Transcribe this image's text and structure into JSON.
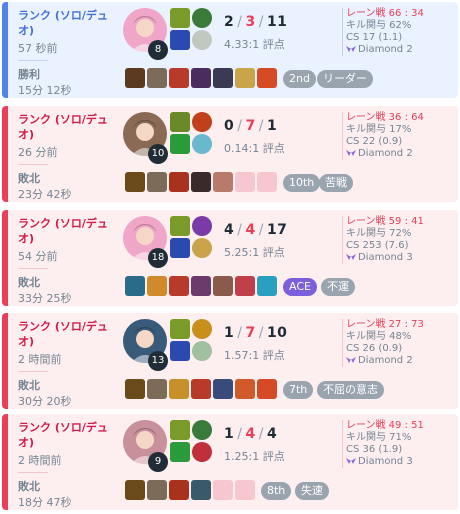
{
  "matches": [
    {
      "result_type": "win",
      "queue": "ランク (ソロ/デュオ)",
      "ago": "57 秒前",
      "result": "勝利",
      "duration": "15分 12秒",
      "level": "8",
      "kills": "2",
      "deaths": "3",
      "assists": "11",
      "ratio": "4.33:1 評点",
      "lane": "レーン戦 66 : 34",
      "kill_participation": "キル関与 62%",
      "cs": "CS 17 (1.1)",
      "rank": "Diamond 2",
      "place": "2nd",
      "tag": "リーダー",
      "champion_color": "#f0a6c8",
      "items": [
        "#5b3a20",
        "#7d6b5a",
        "#b73a2a",
        "#4a2c5e",
        "#3a3a52",
        "#caa44a",
        "#d64b26"
      ],
      "empty_slots": 0
    },
    {
      "result_type": "loss",
      "queue": "ランク (ソロ/デュオ)",
      "ago": "26 分前",
      "result": "敗北",
      "duration": "23分 42秒",
      "level": "10",
      "kills": "0",
      "deaths": "7",
      "assists": "1",
      "ratio": "0.14:1 評点",
      "lane": "レーン戦 36 : 64",
      "kill_participation": "キル関与 17%",
      "cs": "CS 22 (0.9)",
      "rank": "Diamond 2",
      "place": "10th",
      "tag": "苦戦",
      "champion_color": "#8a6a55",
      "items": [
        "#6b4a1a",
        "#7d6b5a",
        "#a8321e",
        "#3a2a2a",
        "#b87a6a"
      ],
      "empty_slots": 2
    },
    {
      "result_type": "loss",
      "queue": "ランク (ソロ/デュオ)",
      "ago": "54 分前",
      "result": "敗北",
      "duration": "33分 25秒",
      "level": "18",
      "kills": "4",
      "deaths": "4",
      "assists": "17",
      "ratio": "5.25:1 評点",
      "lane": "レーン戦 59 : 41",
      "kill_participation": "キル関与 72%",
      "cs": "CS 253 (7.6)",
      "rank": "Diamond 3",
      "place": "ACE",
      "tag": "不運",
      "champion_color": "#f0a6c8",
      "items": [
        "#2a6a8a",
        "#d08a2a",
        "#b73a2a",
        "#6a3a6a",
        "#8a5a4a",
        "#c0404a",
        "#2aa0c0"
      ],
      "empty_slots": 0
    },
    {
      "result_type": "loss",
      "queue": "ランク (ソロ/デュオ)",
      "ago": "2 時間前",
      "result": "敗北",
      "duration": "30分 20秒",
      "level": "13",
      "kills": "1",
      "deaths": "7",
      "assists": "10",
      "ratio": "1.57:1 評点",
      "lane": "レーン戦 27 : 73",
      "kill_participation": "キル関与 48%",
      "cs": "CS 26 (0.9)",
      "rank": "Diamond 2",
      "place": "7th",
      "tag": "不屈の意志",
      "champion_color": "#3a5a7a",
      "items": [
        "#6b4a1a",
        "#7d6b5a",
        "#c8902a",
        "#b83a2a",
        "#3a4a7a",
        "#d05a2a",
        "#d64b26"
      ],
      "empty_slots": 0
    },
    {
      "result_type": "loss",
      "queue": "ランク (ソロ/デュオ)",
      "ago": "2 時間前",
      "result": "敗北",
      "duration": "18分 47秒",
      "level": "9",
      "kills": "1",
      "deaths": "4",
      "assists": "4",
      "ratio": "1.25:1 評点",
      "lane": "レーン戦 49 : 51",
      "kill_participation": "キル関与 71%",
      "cs": "CS 36 (1.9)",
      "rank": "Diamond 3",
      "place": "8th",
      "tag": "失速",
      "champion_color": "#c8909a",
      "items": [
        "#6b4a1a",
        "#7d6b5a",
        "#a8321e",
        "#3a5a6a"
      ],
      "empty_slots": 2
    }
  ]
}
